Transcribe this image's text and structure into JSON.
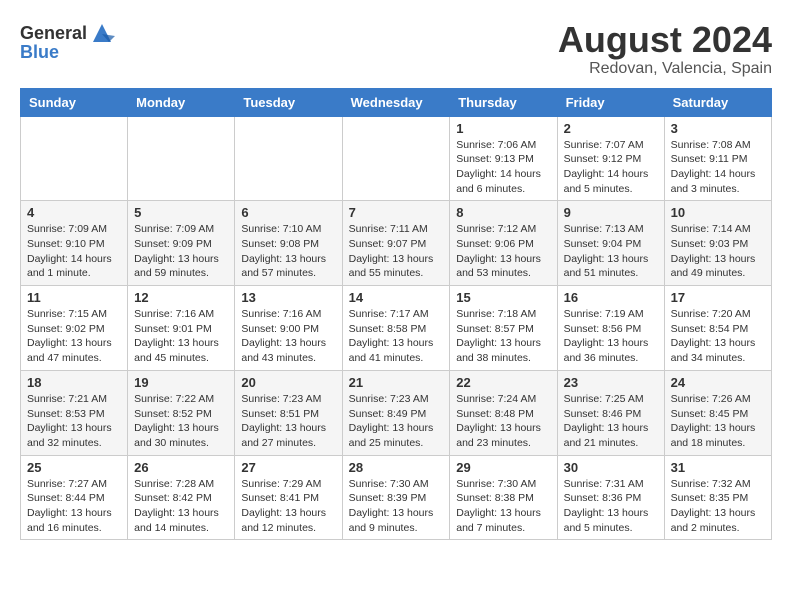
{
  "header": {
    "logo": {
      "general": "General",
      "blue": "Blue"
    },
    "title": "August 2024",
    "location": "Redovan, Valencia, Spain"
  },
  "calendar": {
    "weekdays": [
      "Sunday",
      "Monday",
      "Tuesday",
      "Wednesday",
      "Thursday",
      "Friday",
      "Saturday"
    ],
    "weeks": [
      [
        {
          "day": "",
          "info": ""
        },
        {
          "day": "",
          "info": ""
        },
        {
          "day": "",
          "info": ""
        },
        {
          "day": "",
          "info": ""
        },
        {
          "day": "1",
          "info": "Sunrise: 7:06 AM\nSunset: 9:13 PM\nDaylight: 14 hours\nand 6 minutes."
        },
        {
          "day": "2",
          "info": "Sunrise: 7:07 AM\nSunset: 9:12 PM\nDaylight: 14 hours\nand 5 minutes."
        },
        {
          "day": "3",
          "info": "Sunrise: 7:08 AM\nSunset: 9:11 PM\nDaylight: 14 hours\nand 3 minutes."
        }
      ],
      [
        {
          "day": "4",
          "info": "Sunrise: 7:09 AM\nSunset: 9:10 PM\nDaylight: 14 hours\nand 1 minute."
        },
        {
          "day": "5",
          "info": "Sunrise: 7:09 AM\nSunset: 9:09 PM\nDaylight: 13 hours\nand 59 minutes."
        },
        {
          "day": "6",
          "info": "Sunrise: 7:10 AM\nSunset: 9:08 PM\nDaylight: 13 hours\nand 57 minutes."
        },
        {
          "day": "7",
          "info": "Sunrise: 7:11 AM\nSunset: 9:07 PM\nDaylight: 13 hours\nand 55 minutes."
        },
        {
          "day": "8",
          "info": "Sunrise: 7:12 AM\nSunset: 9:06 PM\nDaylight: 13 hours\nand 53 minutes."
        },
        {
          "day": "9",
          "info": "Sunrise: 7:13 AM\nSunset: 9:04 PM\nDaylight: 13 hours\nand 51 minutes."
        },
        {
          "day": "10",
          "info": "Sunrise: 7:14 AM\nSunset: 9:03 PM\nDaylight: 13 hours\nand 49 minutes."
        }
      ],
      [
        {
          "day": "11",
          "info": "Sunrise: 7:15 AM\nSunset: 9:02 PM\nDaylight: 13 hours\nand 47 minutes."
        },
        {
          "day": "12",
          "info": "Sunrise: 7:16 AM\nSunset: 9:01 PM\nDaylight: 13 hours\nand 45 minutes."
        },
        {
          "day": "13",
          "info": "Sunrise: 7:16 AM\nSunset: 9:00 PM\nDaylight: 13 hours\nand 43 minutes."
        },
        {
          "day": "14",
          "info": "Sunrise: 7:17 AM\nSunset: 8:58 PM\nDaylight: 13 hours\nand 41 minutes."
        },
        {
          "day": "15",
          "info": "Sunrise: 7:18 AM\nSunset: 8:57 PM\nDaylight: 13 hours\nand 38 minutes."
        },
        {
          "day": "16",
          "info": "Sunrise: 7:19 AM\nSunset: 8:56 PM\nDaylight: 13 hours\nand 36 minutes."
        },
        {
          "day": "17",
          "info": "Sunrise: 7:20 AM\nSunset: 8:54 PM\nDaylight: 13 hours\nand 34 minutes."
        }
      ],
      [
        {
          "day": "18",
          "info": "Sunrise: 7:21 AM\nSunset: 8:53 PM\nDaylight: 13 hours\nand 32 minutes."
        },
        {
          "day": "19",
          "info": "Sunrise: 7:22 AM\nSunset: 8:52 PM\nDaylight: 13 hours\nand 30 minutes."
        },
        {
          "day": "20",
          "info": "Sunrise: 7:23 AM\nSunset: 8:51 PM\nDaylight: 13 hours\nand 27 minutes."
        },
        {
          "day": "21",
          "info": "Sunrise: 7:23 AM\nSunset: 8:49 PM\nDaylight: 13 hours\nand 25 minutes."
        },
        {
          "day": "22",
          "info": "Sunrise: 7:24 AM\nSunset: 8:48 PM\nDaylight: 13 hours\nand 23 minutes."
        },
        {
          "day": "23",
          "info": "Sunrise: 7:25 AM\nSunset: 8:46 PM\nDaylight: 13 hours\nand 21 minutes."
        },
        {
          "day": "24",
          "info": "Sunrise: 7:26 AM\nSunset: 8:45 PM\nDaylight: 13 hours\nand 18 minutes."
        }
      ],
      [
        {
          "day": "25",
          "info": "Sunrise: 7:27 AM\nSunset: 8:44 PM\nDaylight: 13 hours\nand 16 minutes."
        },
        {
          "day": "26",
          "info": "Sunrise: 7:28 AM\nSunset: 8:42 PM\nDaylight: 13 hours\nand 14 minutes."
        },
        {
          "day": "27",
          "info": "Sunrise: 7:29 AM\nSunset: 8:41 PM\nDaylight: 13 hours\nand 12 minutes."
        },
        {
          "day": "28",
          "info": "Sunrise: 7:30 AM\nSunset: 8:39 PM\nDaylight: 13 hours\nand 9 minutes."
        },
        {
          "day": "29",
          "info": "Sunrise: 7:30 AM\nSunset: 8:38 PM\nDaylight: 13 hours\nand 7 minutes."
        },
        {
          "day": "30",
          "info": "Sunrise: 7:31 AM\nSunset: 8:36 PM\nDaylight: 13 hours\nand 5 minutes."
        },
        {
          "day": "31",
          "info": "Sunrise: 7:32 AM\nSunset: 8:35 PM\nDaylight: 13 hours\nand 2 minutes."
        }
      ]
    ]
  }
}
